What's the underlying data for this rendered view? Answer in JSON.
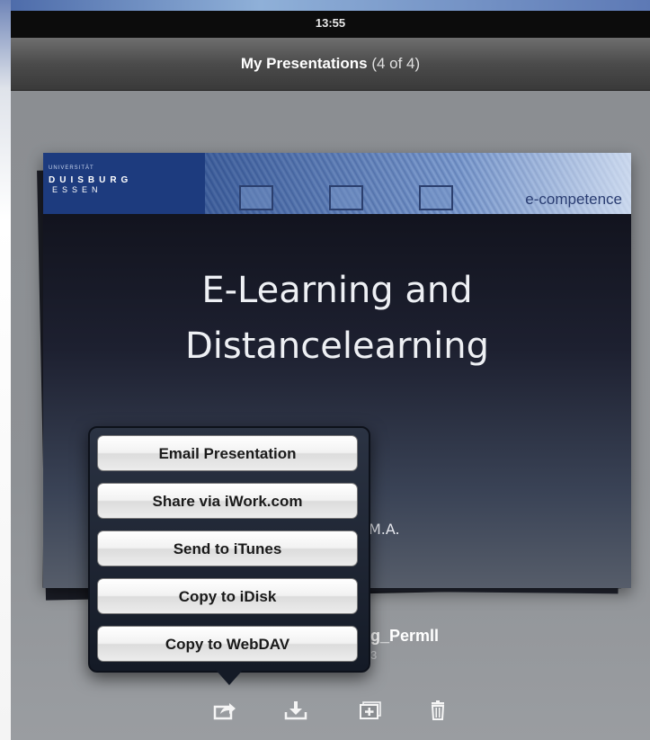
{
  "status_bar": {
    "time": "13:55"
  },
  "navbar": {
    "title": "My Presentations",
    "count": "(4 of 4)"
  },
  "slide": {
    "university_top": "UNIVERSITÄT",
    "university_main": "DUISBURG",
    "university_sub": "ESSEN",
    "brand": "e-competence",
    "title_line1": "E-Learning and",
    "title_line2": "Distancelearning",
    "author_suffix": "M.A."
  },
  "file": {
    "name_partial": "g_Permll",
    "date_partial": "3"
  },
  "share_menu": {
    "items": [
      {
        "label": "Email Presentation"
      },
      {
        "label": "Share via iWork.com"
      },
      {
        "label": "Send to iTunes"
      },
      {
        "label": "Copy to iDisk"
      },
      {
        "label": "Copy to WebDAV"
      }
    ]
  },
  "toolbar": {
    "icons": [
      "share-icon",
      "download-icon",
      "add-icon",
      "trash-icon"
    ]
  }
}
